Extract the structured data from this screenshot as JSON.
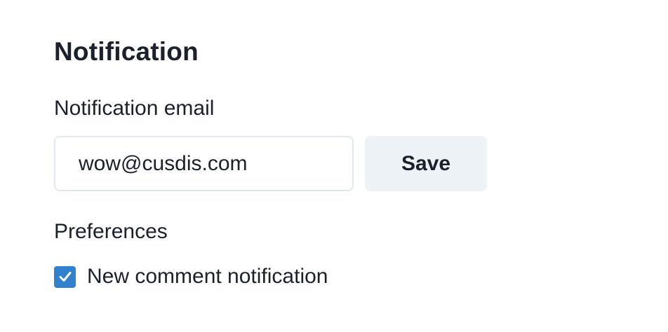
{
  "notification": {
    "title": "Notification",
    "email_label": "Notification email",
    "email_value": "wow@cusdis.com",
    "save_label": "Save",
    "preferences_label": "Preferences",
    "new_comment_label": "New comment notification",
    "new_comment_checked": true
  },
  "icons": {
    "checkbox": "check-icon"
  },
  "colors": {
    "text": "#1a202c",
    "input_border": "#e2e8f0",
    "button_bg": "#edf2f7",
    "checkbox_bg": "#3182ce"
  }
}
